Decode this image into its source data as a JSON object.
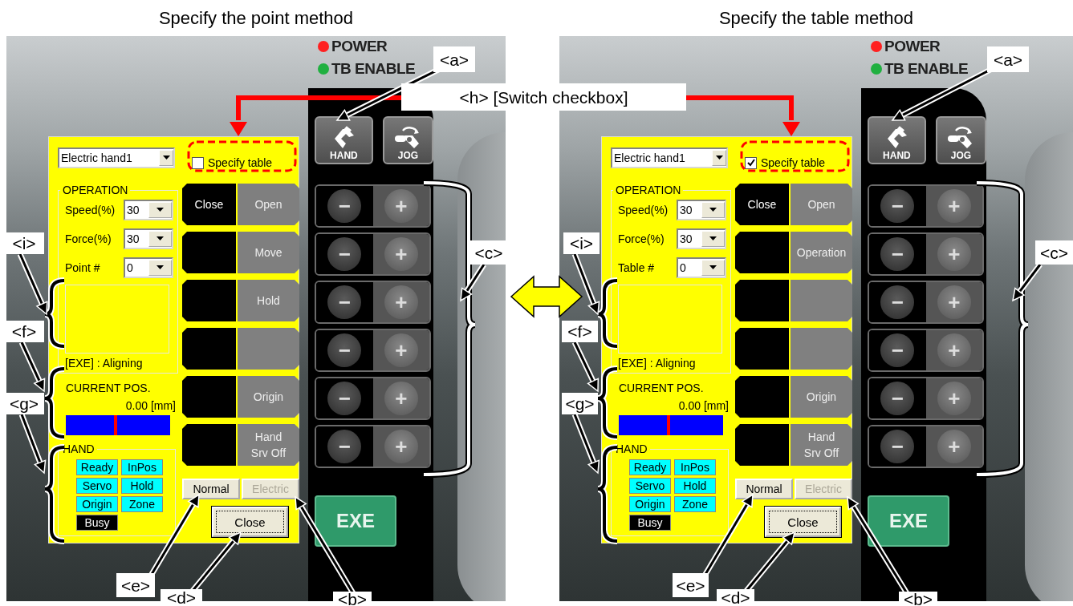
{
  "panels": [
    {
      "title": "Specify the point method",
      "leds": [
        {
          "label": "POWER",
          "color": "#ff2020"
        },
        {
          "label": "TB ENABLE",
          "color": "#20b040"
        }
      ],
      "mode_keys": [
        {
          "label": "HAND"
        },
        {
          "label": "JOG"
        }
      ],
      "jog_keys": [
        {
          "minus": "−",
          "plus": "+"
        },
        {
          "minus": "−",
          "plus": "+"
        },
        {
          "minus": "−",
          "plus": "+"
        },
        {
          "minus": "−",
          "plus": "+"
        },
        {
          "minus": "−",
          "plus": "+"
        },
        {
          "minus": "−",
          "plus": "+"
        }
      ],
      "exe": "EXE",
      "dialog": {
        "device": "Electric hand1",
        "specify_table": {
          "label": "Specify table",
          "checked": false
        },
        "operation": {
          "title": "OPERATION",
          "rows": [
            {
              "label": "Speed(%)",
              "value": "30"
            },
            {
              "label": "Force(%)",
              "value": "30"
            },
            {
              "label": "Point #",
              "value": "0"
            }
          ]
        },
        "status": "[EXE] : Aligning",
        "current_pos": {
          "title": "CURRENT POS.",
          "value": "0.00 [mm]",
          "level": 0.48
        },
        "hand": {
          "title": "HAND",
          "flags": [
            {
              "label": "Ready",
              "on": true
            },
            {
              "label": "InPos",
              "on": true
            },
            {
              "label": "Servo",
              "on": true
            },
            {
              "label": "Hold",
              "on": true
            },
            {
              "label": "Origin",
              "on": true
            },
            {
              "label": "Zone",
              "on": true
            },
            {
              "label": "Busy",
              "on": false
            }
          ]
        },
        "actions": [
          {
            "kind": "labeled",
            "left": "Close",
            "right": "Open"
          },
          {
            "kind": "labeled",
            "right": "Move"
          },
          {
            "kind": "labeled",
            "right": "Hold"
          },
          {
            "kind": "blank"
          },
          {
            "kind": "labeled",
            "right": "Origin"
          },
          {
            "kind": "labeled",
            "right": "Hand\nSrv Off"
          }
        ],
        "mode_buttons": [
          {
            "label": "Normal",
            "disabled": false
          },
          {
            "label": "Electric",
            "disabled": true
          }
        ],
        "close": "Close"
      }
    },
    {
      "title": "Specify the table method",
      "leds": [
        {
          "label": "POWER",
          "color": "#ff2020"
        },
        {
          "label": "TB ENABLE",
          "color": "#20b040"
        }
      ],
      "mode_keys": [
        {
          "label": "HAND"
        },
        {
          "label": "JOG"
        }
      ],
      "jog_keys": [
        {
          "minus": "−",
          "plus": "+"
        },
        {
          "minus": "−",
          "plus": "+"
        },
        {
          "minus": "−",
          "plus": "+"
        },
        {
          "minus": "−",
          "plus": "+"
        },
        {
          "minus": "−",
          "plus": "+"
        },
        {
          "minus": "−",
          "plus": "+"
        }
      ],
      "exe": "EXE",
      "dialog": {
        "device": "Electric hand1",
        "specify_table": {
          "label": "Specify table",
          "checked": true
        },
        "operation": {
          "title": "OPERATION",
          "rows": [
            {
              "label": "Speed(%)",
              "value": "30"
            },
            {
              "label": "Force(%)",
              "value": "30"
            },
            {
              "label": "Table #",
              "value": "0"
            }
          ]
        },
        "status": "[EXE] : Aligning",
        "current_pos": {
          "title": "CURRENT POS.",
          "value": "0.00 [mm]",
          "level": 0.48
        },
        "hand": {
          "title": "HAND",
          "flags": [
            {
              "label": "Ready",
              "on": true
            },
            {
              "label": "InPos",
              "on": true
            },
            {
              "label": "Servo",
              "on": true
            },
            {
              "label": "Hold",
              "on": true
            },
            {
              "label": "Origin",
              "on": true
            },
            {
              "label": "Zone",
              "on": true
            },
            {
              "label": "Busy",
              "on": false
            }
          ]
        },
        "actions": [
          {
            "kind": "labeled",
            "left": "Close",
            "right": "Open"
          },
          {
            "kind": "labeled",
            "right": "Operation"
          },
          {
            "kind": "blank"
          },
          {
            "kind": "blank"
          },
          {
            "kind": "labeled",
            "right": "Origin"
          },
          {
            "kind": "labeled",
            "right": "Hand\nSrv Off"
          }
        ],
        "mode_buttons": [
          {
            "label": "Normal",
            "disabled": false
          },
          {
            "label": "Electric",
            "disabled": true
          }
        ],
        "close": "Close"
      }
    }
  ],
  "switch_note": "<h> [Switch checkbox]",
  "callouts": [
    {
      "label": "<a>"
    },
    {
      "label": "<i>"
    },
    {
      "label": "<c>"
    },
    {
      "label": "<f>"
    },
    {
      "label": "<g>"
    },
    {
      "label": "<e>"
    },
    {
      "label": "<d>"
    },
    {
      "label": "<b>"
    },
    {
      "label": "<a>"
    },
    {
      "label": "<i>"
    },
    {
      "label": "<c>"
    },
    {
      "label": "<f>"
    },
    {
      "label": "<g>"
    },
    {
      "label": "<e>"
    },
    {
      "label": "<d>"
    },
    {
      "label": "<b>"
    }
  ]
}
